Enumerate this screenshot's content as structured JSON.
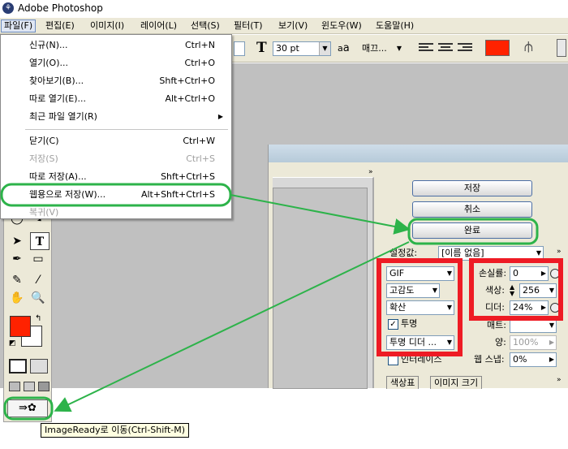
{
  "window": {
    "title": "Adobe Photoshop",
    "app_icon": "photoshop-icon"
  },
  "menubar": [
    "파일(F)",
    "편집(E)",
    "이미지(I)",
    "레이어(L)",
    "선택(S)",
    "필터(T)",
    "보기(V)",
    "윈도우(W)",
    "도움말(H)"
  ],
  "options": {
    "font_size": "30 pt",
    "aa_label": "a",
    "aa_value": "매끄...",
    "text_color": "#ff2200"
  },
  "file_menu": [
    {
      "label": "신규(N)...",
      "shortcut": "Ctrl+N"
    },
    {
      "label": "열기(O)...",
      "shortcut": "Ctrl+O"
    },
    {
      "label": "찾아보기(B)...",
      "shortcut": "Shft+Ctrl+O"
    },
    {
      "label": "따로 열기(E)...",
      "shortcut": "Alt+Ctrl+O"
    },
    {
      "label": "최근 파일 열기(R)",
      "shortcut": ""
    },
    {
      "label": "닫기(C)",
      "shortcut": "Ctrl+W"
    },
    {
      "label": "저장(S)",
      "shortcut": "Ctrl+S"
    },
    {
      "label": "따로 저장(A)...",
      "shortcut": "Shft+Ctrl+S"
    },
    {
      "label": "웹용으로 저장(W)...",
      "shortcut": "Alt+Shft+Ctrl+S"
    },
    {
      "label": "복귀(V)",
      "shortcut": ""
    }
  ],
  "dialog": {
    "buttons": {
      "save": "저장",
      "cancel": "취소",
      "done": "완료"
    },
    "settings_label": "설정값:",
    "settings_value": "[이름 없음]",
    "format": "GIF",
    "reduction": "고감도",
    "dither_algo": "확산",
    "transparency_label": "투명",
    "transparency_checked": true,
    "transparency_dither": "투명 디더 ...",
    "interlace_label": "인터레이스",
    "lossy_label": "손실률:",
    "lossy_value": "0",
    "colors_label": "색상:",
    "colors_value": "256",
    "dither_label": "디더:",
    "dither_value": "24%",
    "matte_label": "매트:",
    "amount_label": "양:",
    "amount_value": "100%",
    "websnap_label": "웹 스냅:",
    "websnap_value": "0%",
    "tabs": [
      "색상표",
      "이미지 크기"
    ]
  },
  "tooltip": "ImageReady로 이동(Ctrl-Shift-M)",
  "colors": {
    "highlight_green": "#2db34a",
    "highlight_red": "#ee1b24",
    "foreground": "#ff2200"
  }
}
